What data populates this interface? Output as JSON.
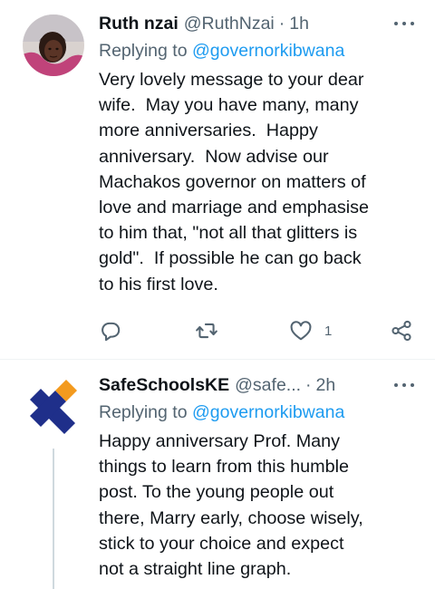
{
  "tweets": [
    {
      "name": "Ruth nzai",
      "handle": "@RuthNzai",
      "separator": "·",
      "time": "1h",
      "replying_label": "Replying to",
      "replying_handle": "@governorkibwana",
      "text": "Very lovely message to your dear\nwife.  May you have many, many\nmore anniversaries.  Happy\nanniversary.  Now advise our\nMachakos governor on matters of\nlove and marriage and emphasise\nto him that, \"not all that glitters is\ngold\".  If possible he can go back\nto his first love.",
      "like_count": "1"
    },
    {
      "name": "SafeSchoolsKE",
      "handle": "@safe...",
      "separator": "·",
      "time": "2h",
      "replying_label": "Replying to",
      "replying_handle": "@governorkibwana",
      "text": "Happy anniversary Prof. Many\nthings to learn from this humble\npost. To the young people out\nthere, Marry early, choose wisely,\nstick to your choice and expect\nnot a straight line graph."
    }
  ],
  "colors": {
    "text": "#0f1419",
    "secondary": "#536471",
    "link": "#1d9bf0",
    "divider": "#eff3f4",
    "logo_blue": "#1f2f8a",
    "logo_orange": "#f39a1e"
  },
  "icons": [
    "more-icon",
    "reply-icon",
    "retweet-icon",
    "like-icon",
    "share-icon"
  ]
}
